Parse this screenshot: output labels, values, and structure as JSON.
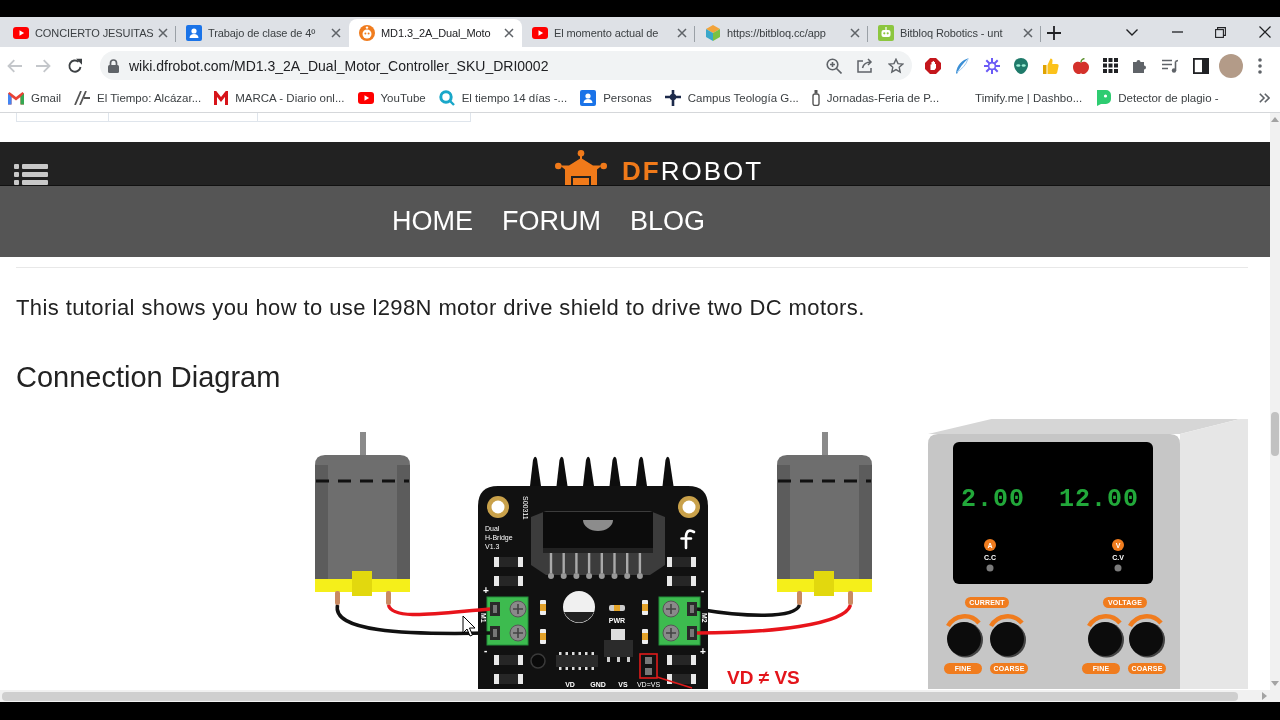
{
  "browser": {
    "tabs": [
      {
        "title": "CONCIERTO JESUITAS",
        "selected": false
      },
      {
        "title": "Trabajo de clase de 4º",
        "selected": false
      },
      {
        "title": "MD1.3_2A_Dual_Moto",
        "selected": true
      },
      {
        "title": "El momento actual de",
        "selected": false
      },
      {
        "title": "https://bitbloq.cc/app",
        "selected": false
      },
      {
        "title": "Bitbloq Robotics - unt",
        "selected": false
      }
    ],
    "toolbar": {
      "back": {
        "disabled": true
      },
      "forward": {
        "disabled": true
      },
      "url": "wiki.dfrobot.com/MD1.3_2A_Dual_Motor_Controller_SKU_DRI0002"
    },
    "bookmarks": [
      {
        "title": "Gmail"
      },
      {
        "title": "El Tiempo: Alcázar..."
      },
      {
        "title": "MARCA - Diario onl..."
      },
      {
        "title": "YouTube"
      },
      {
        "title": "El tiempo 14 días -..."
      },
      {
        "title": "Personas"
      },
      {
        "title": "Campus Teología G..."
      },
      {
        "title": "Jornadas-Feria de P..."
      },
      {
        "title": "Timify.me | Dashbo..."
      },
      {
        "title": "Detector de plagio -"
      }
    ]
  },
  "page": {
    "header": {
      "logo": {
        "accent": "DF",
        "rest": "ROBOT"
      },
      "nav": [
        {
          "label": "HOME"
        },
        {
          "label": "FORUM"
        },
        {
          "label": "BLOG"
        }
      ]
    },
    "intro": "This tutorial shows you how to use l298N motor drive shield to drive two DC motors.",
    "heading": "Connection Diagram",
    "diagram": {
      "board": {
        "label": [
          "Dual",
          "H-Bridge",
          "V1.3"
        ],
        "code": "S00311",
        "terminals": [
          {
            "label": "M1",
            "top_sign": "+",
            "bottom_sign": "-"
          },
          {
            "label": "M2",
            "top_sign": "-",
            "bottom_sign": "+"
          }
        ],
        "led_label": "PWR",
        "pins": [
          "VD",
          "GND",
          "VS"
        ],
        "jumper_label": "VD=VS"
      },
      "note": "VD ≠ VS",
      "power_supply": {
        "channels": [
          {
            "reading": "2.00",
            "unit": "A",
            "mode": "C.C",
            "label": "CURRENT",
            "knobs": [
              "FINE",
              "COARSE"
            ]
          },
          {
            "reading": "12.00",
            "unit": "V",
            "mode": "C.V",
            "label": "VOLTAGE",
            "knobs": [
              "FINE",
              "COARSE"
            ]
          }
        ]
      }
    }
  }
}
